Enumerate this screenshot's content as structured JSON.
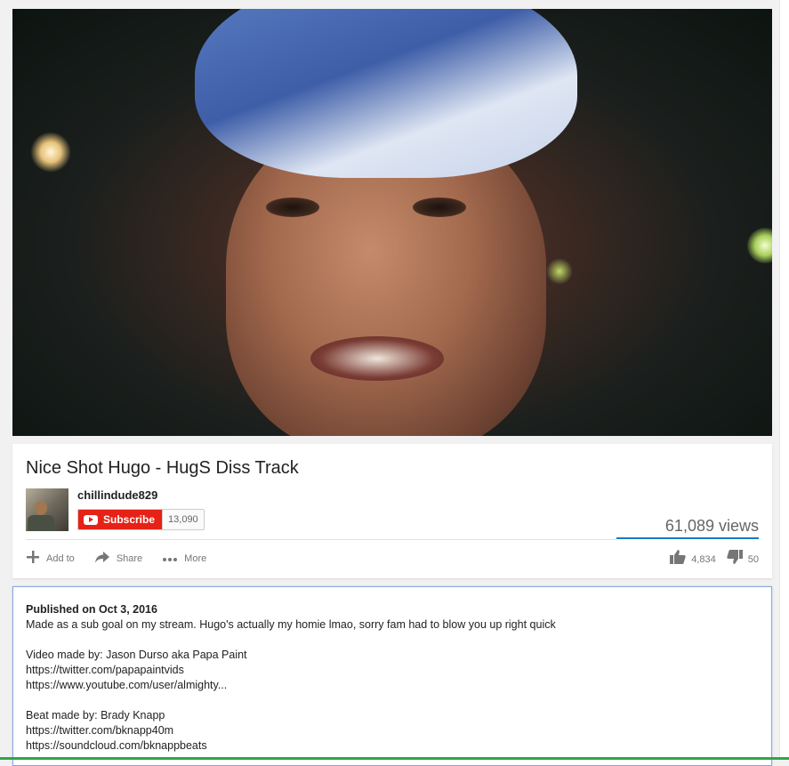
{
  "video": {
    "title": "Nice Shot Hugo - HugS Diss Track",
    "views": "61,089 views"
  },
  "channel": {
    "name": "chillindude829",
    "subscribe_label": "Subscribe",
    "subscriber_count": "13,090"
  },
  "actions": {
    "add_to": "Add to",
    "share": "Share",
    "more": "More",
    "likes": "4,834",
    "dislikes": "50"
  },
  "description": {
    "published": "Published on Oct 3, 2016",
    "lines": [
      "Made as a sub goal on my stream. Hugo's actually my homie lmao, sorry fam had to blow you up right quick",
      "",
      "Video made by: Jason Durso aka Papa Paint",
      "https://twitter.com/papapaintvids",
      "https://www.youtube.com/user/almighty...",
      "",
      "Beat made by: Brady Knapp",
      "https://twitter.com/bknapp40m",
      "https://soundcloud.com/bknappbeats"
    ]
  },
  "icons": {
    "add": "plus-icon",
    "share": "share-arrow-icon",
    "more": "more-dots-icon",
    "like": "thumbs-up-icon",
    "dislike": "thumbs-down-icon",
    "subscribe": "youtube-play-icon"
  },
  "colors": {
    "subscribe_red": "#e62117",
    "views_bar_blue": "#167ac6"
  }
}
